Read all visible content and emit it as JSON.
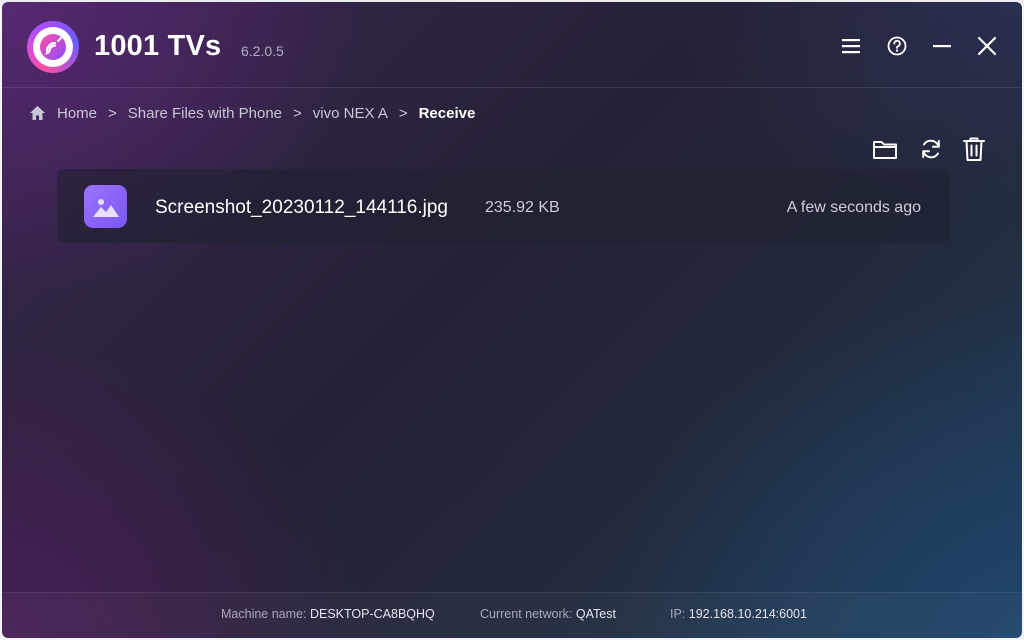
{
  "app": {
    "title": "1001 TVs",
    "version": "6.2.0.5"
  },
  "header_buttons": {
    "menu": "menu-icon",
    "help": "help-icon",
    "minimize": "minimize-icon",
    "close": "close-icon"
  },
  "breadcrumb": {
    "items": [
      "Home",
      "Share Files with Phone",
      "vivo NEX A",
      "Receive"
    ],
    "separator": ">"
  },
  "toolbar": {
    "open_folder": "folder-icon",
    "refresh": "refresh-icon",
    "delete": "trash-icon"
  },
  "files": [
    {
      "name": "Screenshot_20230112_144116.jpg",
      "size": "235.92 KB",
      "time": "A few seconds ago",
      "icon": "image-file-icon"
    }
  ],
  "footer": {
    "machine_label": "Machine name:",
    "machine_value": "DESKTOP-CA8BQHQ",
    "network_label": "Current network:",
    "network_value": "QATest",
    "ip_label": "IP:",
    "ip_value": "192.168.10.214:6001"
  },
  "colors": {
    "accent_purple": "#8b63fa",
    "logo_pink": "#ff4fa3"
  }
}
